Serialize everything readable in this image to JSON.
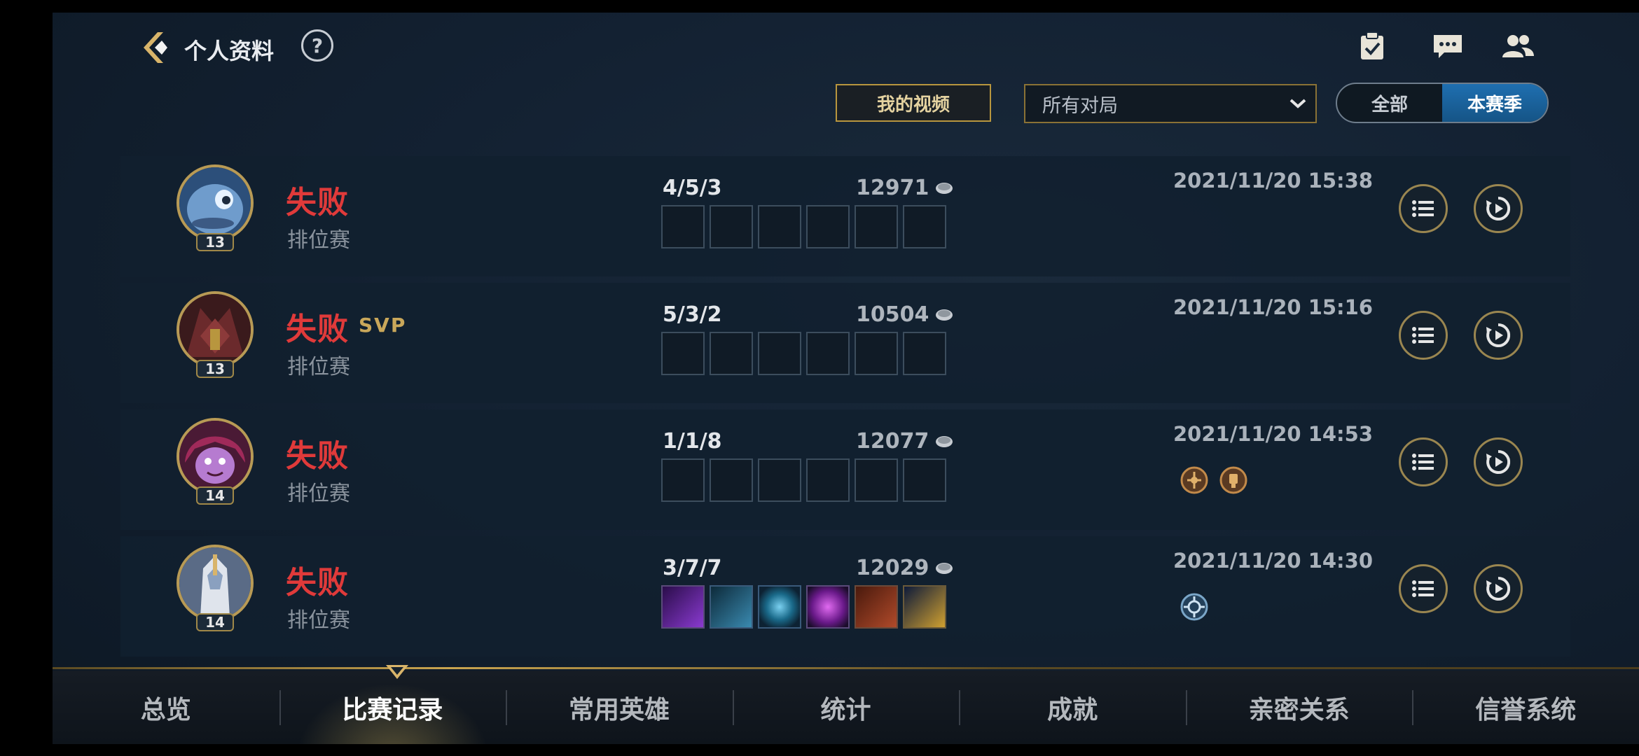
{
  "header": {
    "title": "个人资料",
    "help_label": "?",
    "icons": [
      "task-icon",
      "chat-icon",
      "friends-icon"
    ]
  },
  "filters": {
    "video_button": "我的视频",
    "match_select": {
      "value": "所有对局"
    },
    "segment": {
      "options": [
        "全部",
        "本赛季"
      ],
      "active_index": 1
    }
  },
  "matches": [
    {
      "result": "失败",
      "svp": "",
      "mode": "排位赛",
      "level": "13",
      "kda": "4/5/3",
      "score": "12971",
      "time": "2021/11/20 15:38",
      "avatar": "champion-fizz",
      "items_filled": false,
      "badges": []
    },
    {
      "result": "失败",
      "svp": "SVP",
      "mode": "排位赛",
      "level": "13",
      "kda": "5/3/2",
      "score": "10504",
      "time": "2021/11/20 15:16",
      "avatar": "champion-dark-armor",
      "items_filled": false,
      "badges": []
    },
    {
      "result": "失败",
      "svp": "",
      "mode": "排位赛",
      "level": "14",
      "kda": "1/1/8",
      "score": "12077",
      "time": "2021/11/20 14:53",
      "avatar": "champion-pink-hood",
      "items_filled": false,
      "badges": [
        "medal-icon",
        "trophy-icon"
      ]
    },
    {
      "result": "失败",
      "svp": "",
      "mode": "排位赛",
      "level": "14",
      "kda": "3/7/7",
      "score": "12029",
      "time": "2021/11/20 14:30",
      "avatar": "champion-silver-knight",
      "items_filled": true,
      "badges": [
        "spell-icon"
      ]
    }
  ],
  "nav": {
    "items": [
      "总览",
      "比赛记录",
      "常用英雄",
      "统计",
      "成就",
      "亲密关系",
      "信誉系统"
    ],
    "active_index": 1
  },
  "colors": {
    "defeat": "#e03a3a",
    "gold_border": "#b8963e",
    "active_segment": "#1f6fb0"
  }
}
